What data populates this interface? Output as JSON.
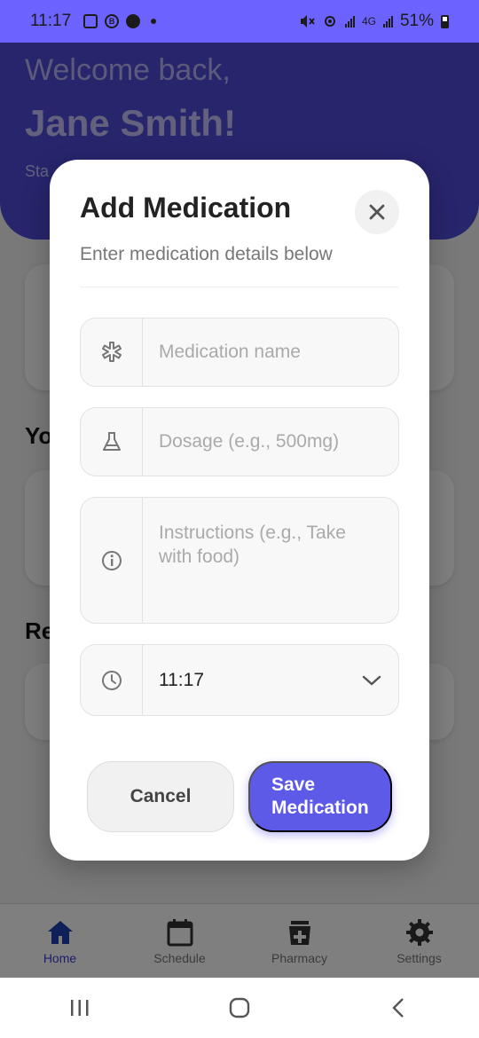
{
  "status_bar": {
    "time": "11:17",
    "battery": "51%",
    "network": "4G"
  },
  "header": {
    "welcome": "Welcome back,",
    "username": "Jane Smith!",
    "subtitle": "Sta"
  },
  "sections": {
    "your": "Yo",
    "reminders": "Re"
  },
  "modal": {
    "title": "Add Medication",
    "subtitle": "Enter medication details below",
    "fields": {
      "name_placeholder": "Medication name",
      "dosage_placeholder": "Dosage (e.g., 500mg)",
      "instructions_placeholder": "Instructions (e.g., Take with food)",
      "time_value": "11:17"
    },
    "cancel_label": "Cancel",
    "save_label": "Save Medication"
  },
  "bottom_nav": {
    "items": [
      {
        "label": "Home",
        "icon": "home-icon",
        "active": true
      },
      {
        "label": "Schedule",
        "icon": "calendar-icon",
        "active": false
      },
      {
        "label": "Pharmacy",
        "icon": "pharmacy-icon",
        "active": false
      },
      {
        "label": "Settings",
        "icon": "gear-icon",
        "active": false
      }
    ]
  },
  "colors": {
    "primary": "#5d5ae8",
    "header": "#4f4ad8",
    "nav_active": "#3b3bd9"
  }
}
